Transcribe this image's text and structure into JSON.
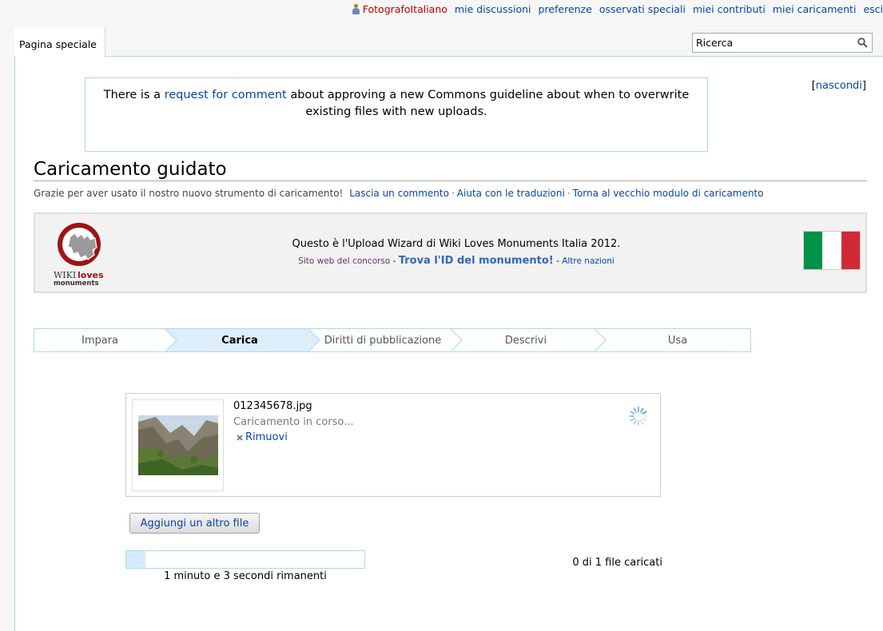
{
  "personal": {
    "username": "FotografoItaliano",
    "links": [
      "mie discussioni",
      "preferenze",
      "osservati speciali",
      "miei contributi",
      "miei caricamenti",
      "esci"
    ]
  },
  "tab": {
    "label": "Pagina speciale"
  },
  "search": {
    "value": "Ricerca"
  },
  "notice": {
    "before": "There is a ",
    "link": "request for comment",
    "after": " about approving a new Commons guideline about when to overwrite existing files with new uploads.",
    "hide": "nascondi"
  },
  "page": {
    "title": "Caricamento guidato",
    "subtitle": "Grazie per aver usato il nostro nuovo strumento di caricamento!",
    "links": [
      "Lascia un commento",
      "Aiuta con le traduzioni",
      "Torna al vecchio modulo di caricamento"
    ]
  },
  "banner": {
    "logo_line1": "WIKI",
    "logo_line1b": "loves",
    "logo_line2": "monuments",
    "main": "Questo è l'Upload Wizard di Wiki Loves Monuments Italia 2012.",
    "contest_link": "Sito web del concorso",
    "find_link": "Trova l'ID del monumento!",
    "other_link": "Altre nazioni",
    "flag_colors": [
      "#009246",
      "#ffffff",
      "#ce2b37"
    ]
  },
  "steps": [
    {
      "label": "Impara",
      "active": false
    },
    {
      "label": "Carica",
      "active": true
    },
    {
      "label": "Diritti di pubblicazione",
      "active": false
    },
    {
      "label": "Descrivi",
      "active": false
    },
    {
      "label": "Usa",
      "active": false
    }
  ],
  "file": {
    "name": "012345678.jpg",
    "status": "Caricamento in corso...",
    "remove": "Rimuovi"
  },
  "add_file": "Aggiungi un altro file",
  "progress": {
    "fraction": 0.08,
    "remaining": "1 minuto e 3 secondi rimanenti",
    "count": "0 di 1 file caricati"
  },
  "colors": {
    "link": "#0645ad",
    "border": "#a7d7f9",
    "active_step": "#ddeef9"
  }
}
